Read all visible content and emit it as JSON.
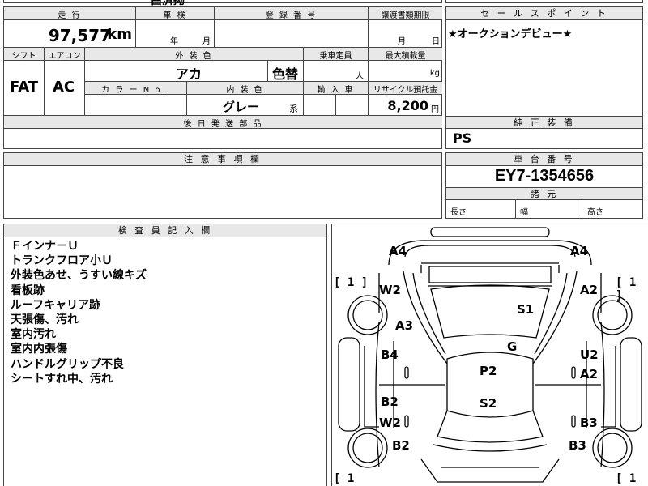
{
  "top_partial": {
    "title_fragment": "昌済拗"
  },
  "mileage": {
    "label": "走 行",
    "value": "97,577",
    "unit": "km"
  },
  "inspection": {
    "label": "車 検",
    "year_unit": "年",
    "month_unit": "月"
  },
  "registration": {
    "label": "登 録 番 号"
  },
  "transfer_docs": {
    "label": "譲渡書類期限",
    "month_unit": "月",
    "day_unit": "日"
  },
  "shift": {
    "label": "シフト",
    "value": "FAT"
  },
  "aircon": {
    "label": "エアコン",
    "value": "AC"
  },
  "exterior_color": {
    "label": "外 装 色",
    "value": "アカ",
    "repaint": "色替"
  },
  "capacity": {
    "label": "乗車定員",
    "unit": "人"
  },
  "max_load": {
    "label": "最大積載量",
    "unit": "kg"
  },
  "color_no": {
    "label": "カ ラ ー N o ."
  },
  "interior_color": {
    "label": "内 装 色",
    "value": "グレー",
    "suffix": "系"
  },
  "import_car": {
    "label": "輸 入 車"
  },
  "recycle": {
    "label": "リサイクル預託金",
    "value": "8,200",
    "unit": "円"
  },
  "shipping_parts": {
    "label": "後 日 発 送 部 品"
  },
  "sales_point": {
    "label": "セ ー ル ス ポ イ ン ト",
    "text": "★オークションデビュー★"
  },
  "genuine_equipment": {
    "label": "純 正 装 備",
    "value": "PS"
  },
  "notes": {
    "label": "注 意 事 項 欄"
  },
  "chassis": {
    "label": "車 台 番 号",
    "value": "EY7-1354656"
  },
  "dimensions": {
    "label": "諸 元",
    "length": "長さ",
    "width": "幅",
    "height": "高さ"
  },
  "inspector": {
    "label": "検 査 員 記 入 欄",
    "remarks": [
      "Ｆインナ－Ｕ",
      "トランクフロア小Ｕ",
      "外装色あせ、うすい線キズ",
      "看板跡",
      "ルーフキャリア跡",
      "天張傷、汚れ",
      "室内汚れ",
      "室内内張傷",
      "ハンドルグリップ不良",
      "シートすれ中、汚れ"
    ]
  },
  "damage_map": {
    "codes": {
      "a4_left": "A4",
      "a4_right": "A4",
      "w2_top": "W2",
      "a2_top": "A2",
      "a3": "A3",
      "s1": "S1",
      "g": "G",
      "b4": "B4",
      "u2": "U2",
      "p2": "P2",
      "a2_mid": "A2",
      "b2_mid": "B2",
      "s2": "S2",
      "w2_bot": "W2",
      "b3_mid": "B3",
      "b2_bot": "B2",
      "b3_bot": "B3"
    },
    "brackets": {
      "tl": "[ 1 ]",
      "tr": "[ 1 ]",
      "bl": "[ 1",
      "br": "[ 1"
    }
  }
}
